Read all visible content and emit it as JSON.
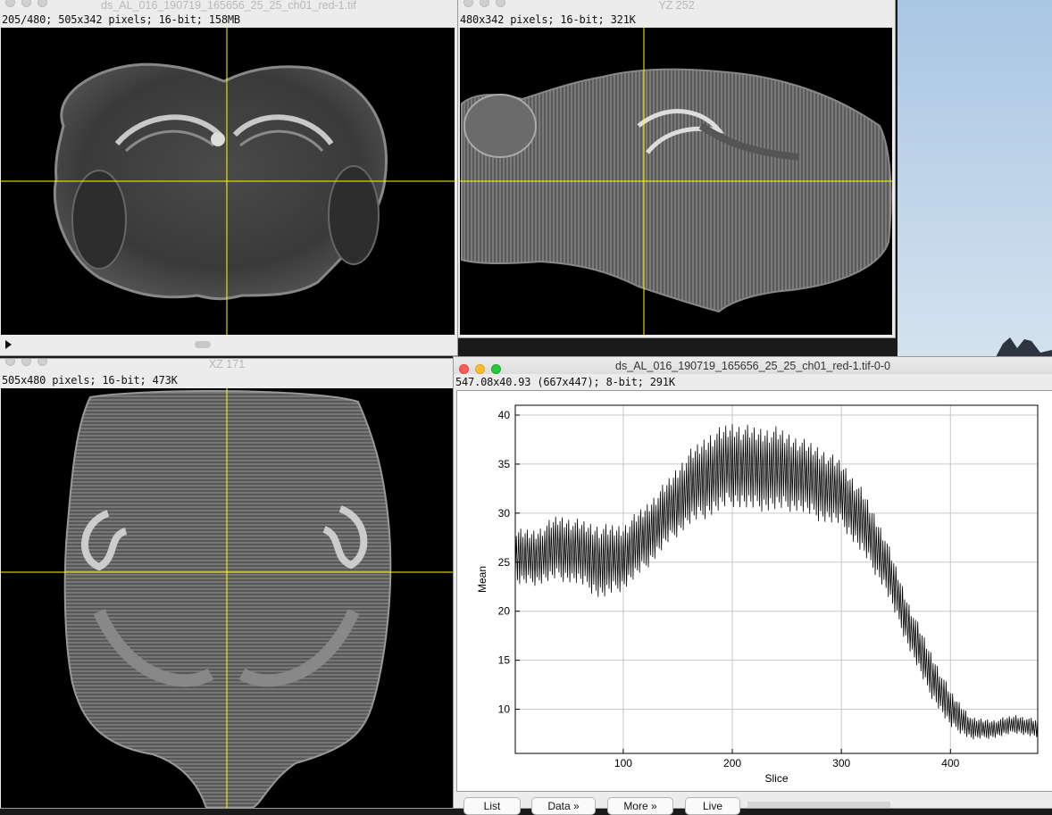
{
  "windows": {
    "main": {
      "title": "ds_AL_016_190719_165656_25_25_ch01_red-1.tif",
      "info": "205/480; 505x342 pixels; 16-bit; 158MB"
    },
    "yz": {
      "title": "YZ 252",
      "info": "480x342 pixels; 16-bit; 321K"
    },
    "xz": {
      "title": "XZ 171",
      "info": "505x480 pixels; 16-bit; 473K"
    },
    "plot": {
      "title": "ds_AL_016_190719_165656_25_25_ch01_red-1.tif-0-0",
      "info": "547.08x40.93   (667x447); 8-bit; 291K"
    }
  },
  "buttons": {
    "list": "List",
    "data": "Data »",
    "more": "More »",
    "live": "Live"
  },
  "colors": {
    "crosshair": "#ffff00",
    "accent_red": "#fd5f57",
    "accent_yellow": "#febc2e",
    "accent_green": "#28c840"
  },
  "slice_slider": {
    "current": 205,
    "total": 480
  },
  "chart_data": {
    "type": "line",
    "title": "",
    "xlabel": "Slice",
    "ylabel": "Mean",
    "xlim": [
      1,
      480
    ],
    "ylim": [
      5.5,
      41
    ],
    "x_ticks": [
      100,
      200,
      300,
      400
    ],
    "y_ticks": [
      10,
      15,
      20,
      25,
      30,
      35,
      40
    ],
    "grid": true,
    "series": [
      {
        "name": "",
        "x": [
          1,
          20,
          40,
          60,
          80,
          100,
          120,
          140,
          160,
          180,
          200,
          220,
          240,
          260,
          280,
          300,
          320,
          340,
          360,
          380,
          400,
          420,
          440,
          460,
          480
        ],
        "y": [
          25.5,
          25.5,
          26.5,
          26,
          25,
          25.5,
          27.5,
          30,
          32.5,
          34,
          35,
          34.5,
          34.5,
          34,
          33,
          32,
          29,
          25,
          19,
          14,
          10,
          8,
          8,
          8.5,
          8
        ],
        "amplitude": [
          3,
          3,
          3.5,
          3.5,
          4,
          3.5,
          3.5,
          3.5,
          4,
          4.5,
          4.5,
          4.5,
          4.5,
          4,
          4,
          3.5,
          3.5,
          3,
          2.5,
          2.5,
          2,
          1.2,
          1,
          1,
          1
        ]
      }
    ]
  }
}
